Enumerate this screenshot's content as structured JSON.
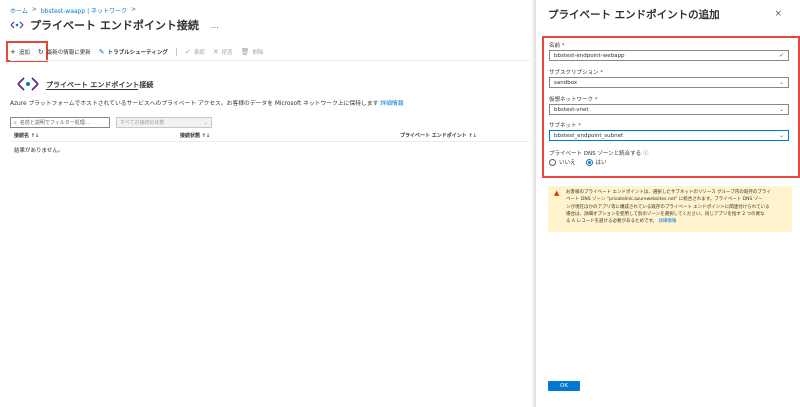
{
  "breadcrumb": {
    "items": [
      "ホーム",
      "bbstest-waapp | ネットワーク"
    ]
  },
  "page": {
    "title": "プライベート エンドポイント接続",
    "more": "…"
  },
  "toolbar": {
    "add": "追加",
    "refresh": "最新の情報に更新",
    "troubleshoot": "トラブルシューティング",
    "approve": "承認",
    "reject": "拒否",
    "remove": "削除"
  },
  "section": {
    "heading": "プライベート エンドポイント接続",
    "description": "Azure プラットフォームでホストされているサービスへのプライベート アクセス。お客様のデータを Microsoft ネットワーク上に保持します",
    "more_info": "詳細情報"
  },
  "filters": {
    "search_placeholder": "名前と説明でフィルター処理...",
    "status_placeholder": "すべての接続の状態"
  },
  "table": {
    "columns": [
      "接続名 ↑↓",
      "接続状態 ↑↓",
      "プライベート エンドポイント ↑↓"
    ],
    "empty": "結果がありません。"
  },
  "blade": {
    "title": "プライベート エンドポイントの追加",
    "close": "×",
    "fields": {
      "name_label": "名前",
      "name_value": "bbstest-endpoint-webapp",
      "subscription_label": "サブスクリプション",
      "subscription_value": "sandbox",
      "vnet_label": "仮想ネットワーク",
      "vnet_value": "bbstest-vnet",
      "subnet_label": "サブネット",
      "subnet_value": "bbstest_endpoint_subnet",
      "required_mark": "*"
    },
    "dns": {
      "label": "プライベート DNS ゾーンと統合する",
      "info": "ⓘ",
      "no": "いいえ",
      "yes": "はい"
    },
    "warning": {
      "lines": [
        "お客様のプライベート エンドポイントは、選択したサブネットのリソース グループ内の既存のプライ",
        "ベート DNS ゾーン \"privatelink.azurewebsites.net\" に統合されます。プライベート DNS ゾー",
        "ンが現在ほかのアプリ等に構成されている既存のプライベート エンドポイントに関連付けられている",
        "場合は、詳細オプションを使用して別のゾーンを選択してください。同じアプリを指す 2 つの異な",
        "る A レコードを避ける必要があるためです。"
      ],
      "link": "詳細情報"
    },
    "ok": "OK"
  },
  "colors": {
    "accent": "#0078d4",
    "highlight": "#e8453c",
    "warning_bg": "#fff4ce"
  }
}
